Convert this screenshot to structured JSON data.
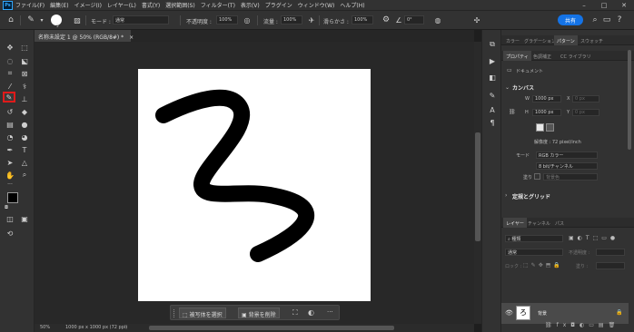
{
  "app": {
    "logo": "Ps"
  },
  "menu": [
    "ファイル(F)",
    "編集(E)",
    "イメージ(I)",
    "レイヤー(L)",
    "書式(Y)",
    "選択範囲(S)",
    "フィルター(T)",
    "表示(V)",
    "プラグイン",
    "ウィンドウ(W)",
    "ヘルプ(H)"
  ],
  "window_controls": {
    "minimize": "–",
    "maximize": "□",
    "close": "✕"
  },
  "options": {
    "brush_size": "5",
    "mode_label": "モード :",
    "mode_value": "通常",
    "opacity_label": "不透明度 :",
    "opacity_value": "100%",
    "flow_label": "流量 :",
    "flow_value": "100%",
    "smoothing_label": "滑らかさ :",
    "smoothing_value": "100%",
    "angle_value": "0°",
    "share_label": "共有"
  },
  "document": {
    "tab_title": "名称未設定 1 @ 50% (RGB/8#) *",
    "tab_close": "×",
    "zoom": "50%",
    "info": "1000 px x 1000 px (72 ppi)"
  },
  "context_bar": {
    "select_subject": "被写体を選択",
    "remove_background": "背景を削除",
    "more": "···"
  },
  "panels": {
    "top_tabs": [
      "カラー",
      "グラデーション",
      "パターン",
      "スウォッチ"
    ],
    "prop_tabs": [
      "プロパティ",
      "色調補正",
      "CC ライブラリ"
    ],
    "doc_label": "ドキュメント",
    "canvas_heading": "カンバス",
    "width_label": "W",
    "width_value": "1000 px",
    "height_label": "H",
    "height_value": "1000 px",
    "x_label": "X",
    "x_value": "0 px",
    "y_label": "Y",
    "y_value": "0 px",
    "resolution": "解像度 : 72 pixel/inch",
    "mode_label": "モード",
    "mode_value": "RGB カラー",
    "bit_value": "8 bit/チャンネル",
    "fill_label": "塗り",
    "fill_value": "背景色",
    "guides_heading": "定規とグリッド",
    "layer_tabs": [
      "レイヤー",
      "チャンネル",
      "パス"
    ],
    "layer_search": "種類",
    "blend_mode": "通常",
    "opacity_label": "不透明度 :",
    "lock_label": "ロック :",
    "fill_label2": "塗り :",
    "layer_name": "背景"
  },
  "colors": {
    "accent": "#1473e6",
    "highlight": "#e01a1a",
    "panel": "#323232"
  }
}
